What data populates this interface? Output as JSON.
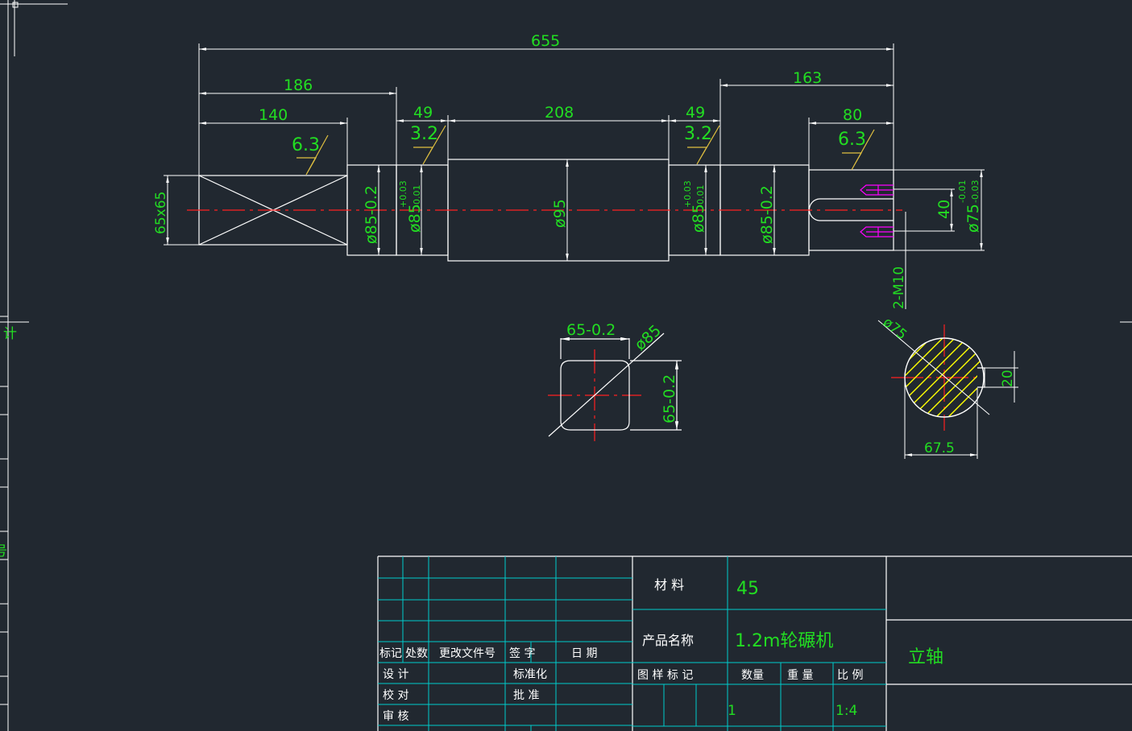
{
  "dimensions": {
    "overall_length": "655",
    "left_length": "186",
    "square_length": "140",
    "journal_left": "49",
    "body_length": "208",
    "journal_right": "49",
    "right_length": "163",
    "end_length": "80",
    "square_size": "65x65",
    "dia_85_left": "ø85-0.2",
    "dia_85_j1": "ø85",
    "tol_j1_upper": "+0.03",
    "tol_j1_lower": "-0.01",
    "dia_95": "ø95",
    "dia_85_j2": "ø85",
    "tol_j2_upper": "+0.03",
    "tol_j2_lower": "-0.01",
    "dia_85_right": "ø85-0.2",
    "dim_40": "40",
    "dia_75": "ø75",
    "tol_75_upper": "-0.01",
    "tol_75_lower": "-0.03",
    "thread": "2-M10",
    "sec_width": "65-0.2",
    "sec_dia": "ø85",
    "sec_height": "65-0.2",
    "keyway_dia": "ø75",
    "keyway_width": "20",
    "keyway_depth": "67.5"
  },
  "roughness": {
    "square": "6.3",
    "journal_left": "3.2",
    "journal_right": "3.2",
    "end": "6.3"
  },
  "title_block": {
    "material_label": "材 料",
    "material_value": "45",
    "product_label": "产品名称",
    "product_value": "1.2m轮碾机",
    "part_name": "立轴",
    "rev_mark": "标记",
    "rev_count": "处数",
    "rev_doc": "更改文件号",
    "rev_sign": "签 字",
    "rev_date": "日 期",
    "design": "设 计",
    "check": "校 对",
    "review": "审 核",
    "standard": "标准化",
    "approve": "批 准",
    "drawing_mark": "图 样 标 记",
    "quantity_label": "数量",
    "weight_label": "重 量",
    "scale_label": "比 例",
    "quantity_value": "1",
    "scale_value": "1:4"
  },
  "colors": {
    "background": "#212830",
    "outline": "#ffffff",
    "dimension": "#22dd22",
    "centerline": "#ff2020",
    "frame": "#00cccc",
    "roughness": "#e0c040",
    "hatch": "#ffff00",
    "thread_mark": "#ff00ff"
  }
}
